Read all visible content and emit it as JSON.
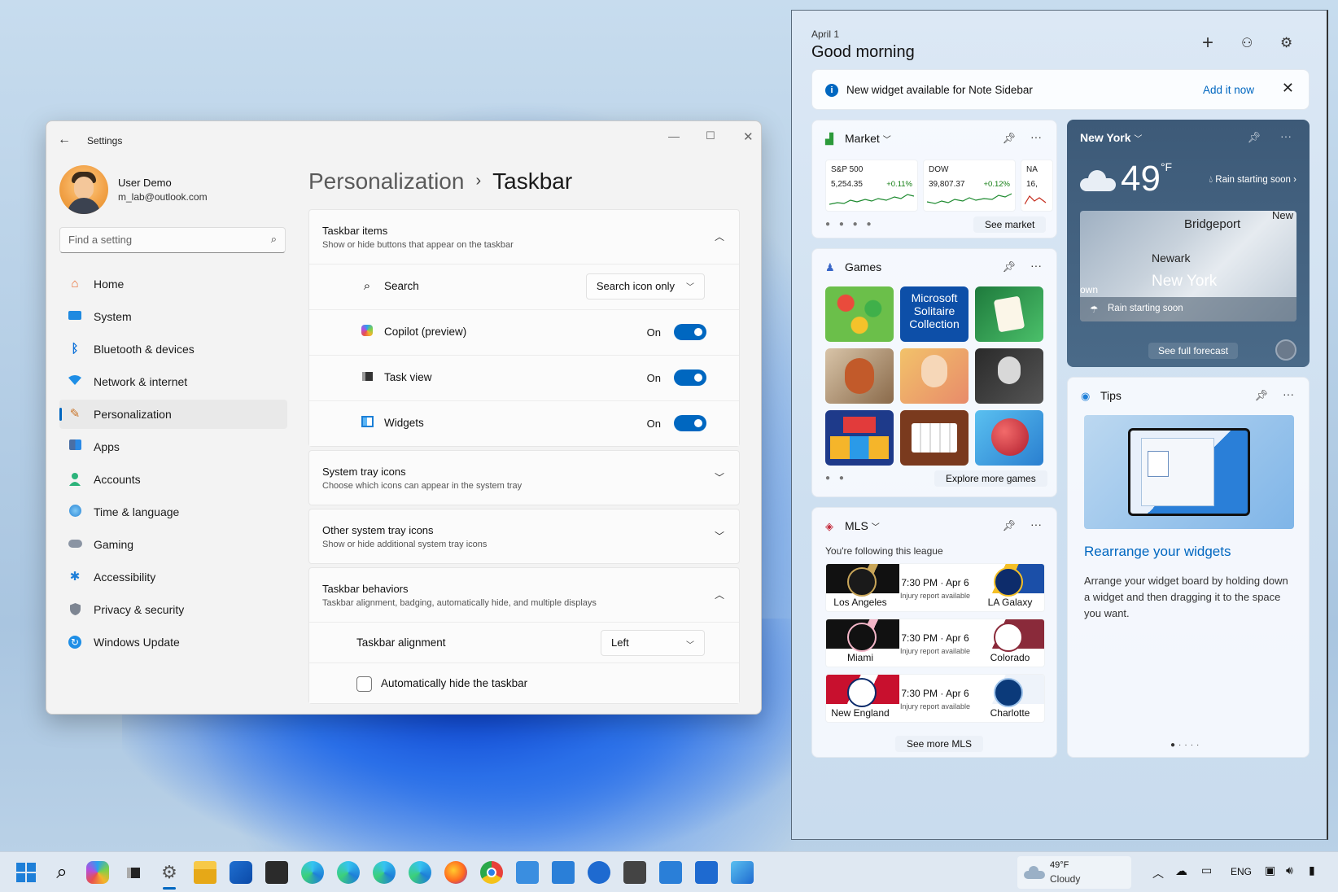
{
  "settings": {
    "window_title": "Settings",
    "user_name": "User Demo",
    "user_email": "m_lab@outlook.com",
    "search_placeholder": "Find a setting",
    "nav": [
      {
        "label": "Home",
        "icon": "home-icon"
      },
      {
        "label": "System",
        "icon": "monitor-icon"
      },
      {
        "label": "Bluetooth & devices",
        "icon": "bluetooth-icon"
      },
      {
        "label": "Network & internet",
        "icon": "wifi-icon"
      },
      {
        "label": "Personalization",
        "icon": "brush-icon",
        "active": true
      },
      {
        "label": "Apps",
        "icon": "apps-icon"
      },
      {
        "label": "Accounts",
        "icon": "person-icon"
      },
      {
        "label": "Time & language",
        "icon": "globe-clock-icon"
      },
      {
        "label": "Gaming",
        "icon": "gamepad-icon"
      },
      {
        "label": "Accessibility",
        "icon": "accessibility-icon"
      },
      {
        "label": "Privacy & security",
        "icon": "shield-icon"
      },
      {
        "label": "Windows Update",
        "icon": "update-icon"
      }
    ],
    "breadcrumb_parent": "Personalization",
    "breadcrumb_sep": "›",
    "breadcrumb_current": "Taskbar",
    "taskbar_items": {
      "title": "Taskbar items",
      "desc": "Show or hide buttons that appear on the taskbar",
      "search_label": "Search",
      "search_value": "Search icon only",
      "copilot_label": "Copilot (preview)",
      "copilot_state": "On",
      "taskview_label": "Task view",
      "taskview_state": "On",
      "widgets_label": "Widgets",
      "widgets_state": "On"
    },
    "system_tray": {
      "title": "System tray icons",
      "desc": "Choose which icons can appear in the system tray"
    },
    "other_tray": {
      "title": "Other system tray icons",
      "desc": "Show or hide additional system tray icons"
    },
    "behaviors": {
      "title": "Taskbar behaviors",
      "desc": "Taskbar alignment, badging, automatically hide, and multiple displays",
      "alignment_label": "Taskbar alignment",
      "alignment_value": "Left",
      "autohide_label": "Automatically hide the taskbar"
    }
  },
  "widgets": {
    "date": "April 1",
    "greeting": "Good morning",
    "banner_text": "New widget available for Note Sidebar",
    "banner_action": "Add it now",
    "market": {
      "title": "Market",
      "stocks": [
        {
          "name": "S&P 500",
          "value": "5,254.35",
          "change": "+0.11%"
        },
        {
          "name": "DOW",
          "value": "39,807.37",
          "change": "+0.12%"
        },
        {
          "name": "NA",
          "value": "16,"
        }
      ],
      "footer": "See market"
    },
    "weather": {
      "city": "New York",
      "temp": "49",
      "unit": "°F",
      "condition": "Rain starting soon",
      "map_labels": [
        "Bridgeport",
        "New",
        "Newark",
        "New York",
        "own"
      ],
      "map_note": "Rain starting soon",
      "footer": "See full forecast"
    },
    "games": {
      "title": "Games",
      "solitaire": "Microsoft Solitaire Collection",
      "footer": "Explore more games"
    },
    "tips": {
      "title": "Tips",
      "heading": "Rearrange your widgets",
      "body": "Arrange your widget board by holding down a widget and then dragging it to the space you want."
    },
    "mls": {
      "title": "MLS",
      "subtitle": "You're following this league",
      "matches": [
        {
          "home": "Los Angeles",
          "away": "LA Galaxy",
          "time": "7:30 PM · Apr 6",
          "info": "Injury report available"
        },
        {
          "home": "Miami",
          "away": "Colorado",
          "time": "7:30 PM · Apr 6",
          "info": "Injury report available"
        },
        {
          "home": "New England",
          "away": "Charlotte",
          "time": "7:30 PM · Apr 6",
          "info": "Injury report available"
        }
      ],
      "footer": "See more MLS"
    }
  },
  "taskbar": {
    "weather_temp": "49°F",
    "weather_cond": "Cloudy",
    "lang": "ENG"
  },
  "colors": {
    "accent": "#0067c0"
  }
}
